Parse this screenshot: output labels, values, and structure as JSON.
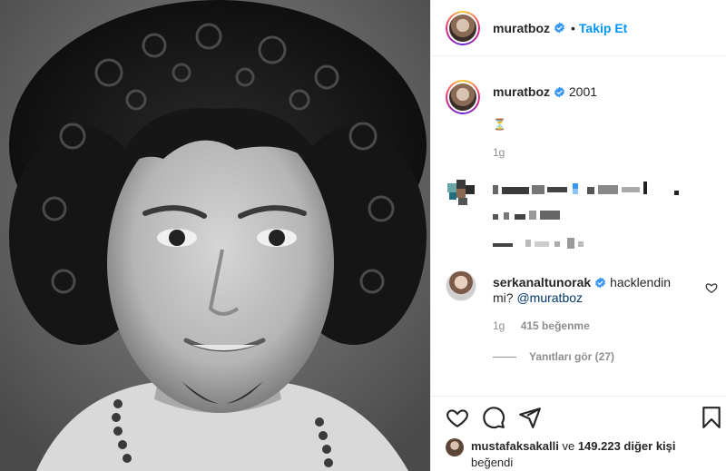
{
  "post": {
    "author": "muratboz",
    "follow_label": "Takip Et",
    "separator": "•"
  },
  "caption": {
    "author": "muratboz",
    "text": "2001",
    "emoji": "⏳",
    "time": "1g"
  },
  "comment": {
    "author": "serkanaltunorak",
    "text": "hacklendin mi?",
    "mention": "@muratboz",
    "time": "1g",
    "likes": "415 beğenme",
    "replies_label": "Yanıtları gör (27)"
  },
  "likes": {
    "user": "mustafaksakalli",
    "connector": "ve",
    "others": "149.223 diğer kişi",
    "suffix": "beğendi"
  },
  "icons": {
    "like": "heart-icon",
    "comment": "comment-icon",
    "share": "paper-plane-icon",
    "save": "bookmark-icon",
    "verified": "verified-badge-icon",
    "comment_like": "heart-icon"
  },
  "colors": {
    "link": "#0095f6",
    "verified": "#3897f0",
    "muted": "#8e8e8e"
  }
}
